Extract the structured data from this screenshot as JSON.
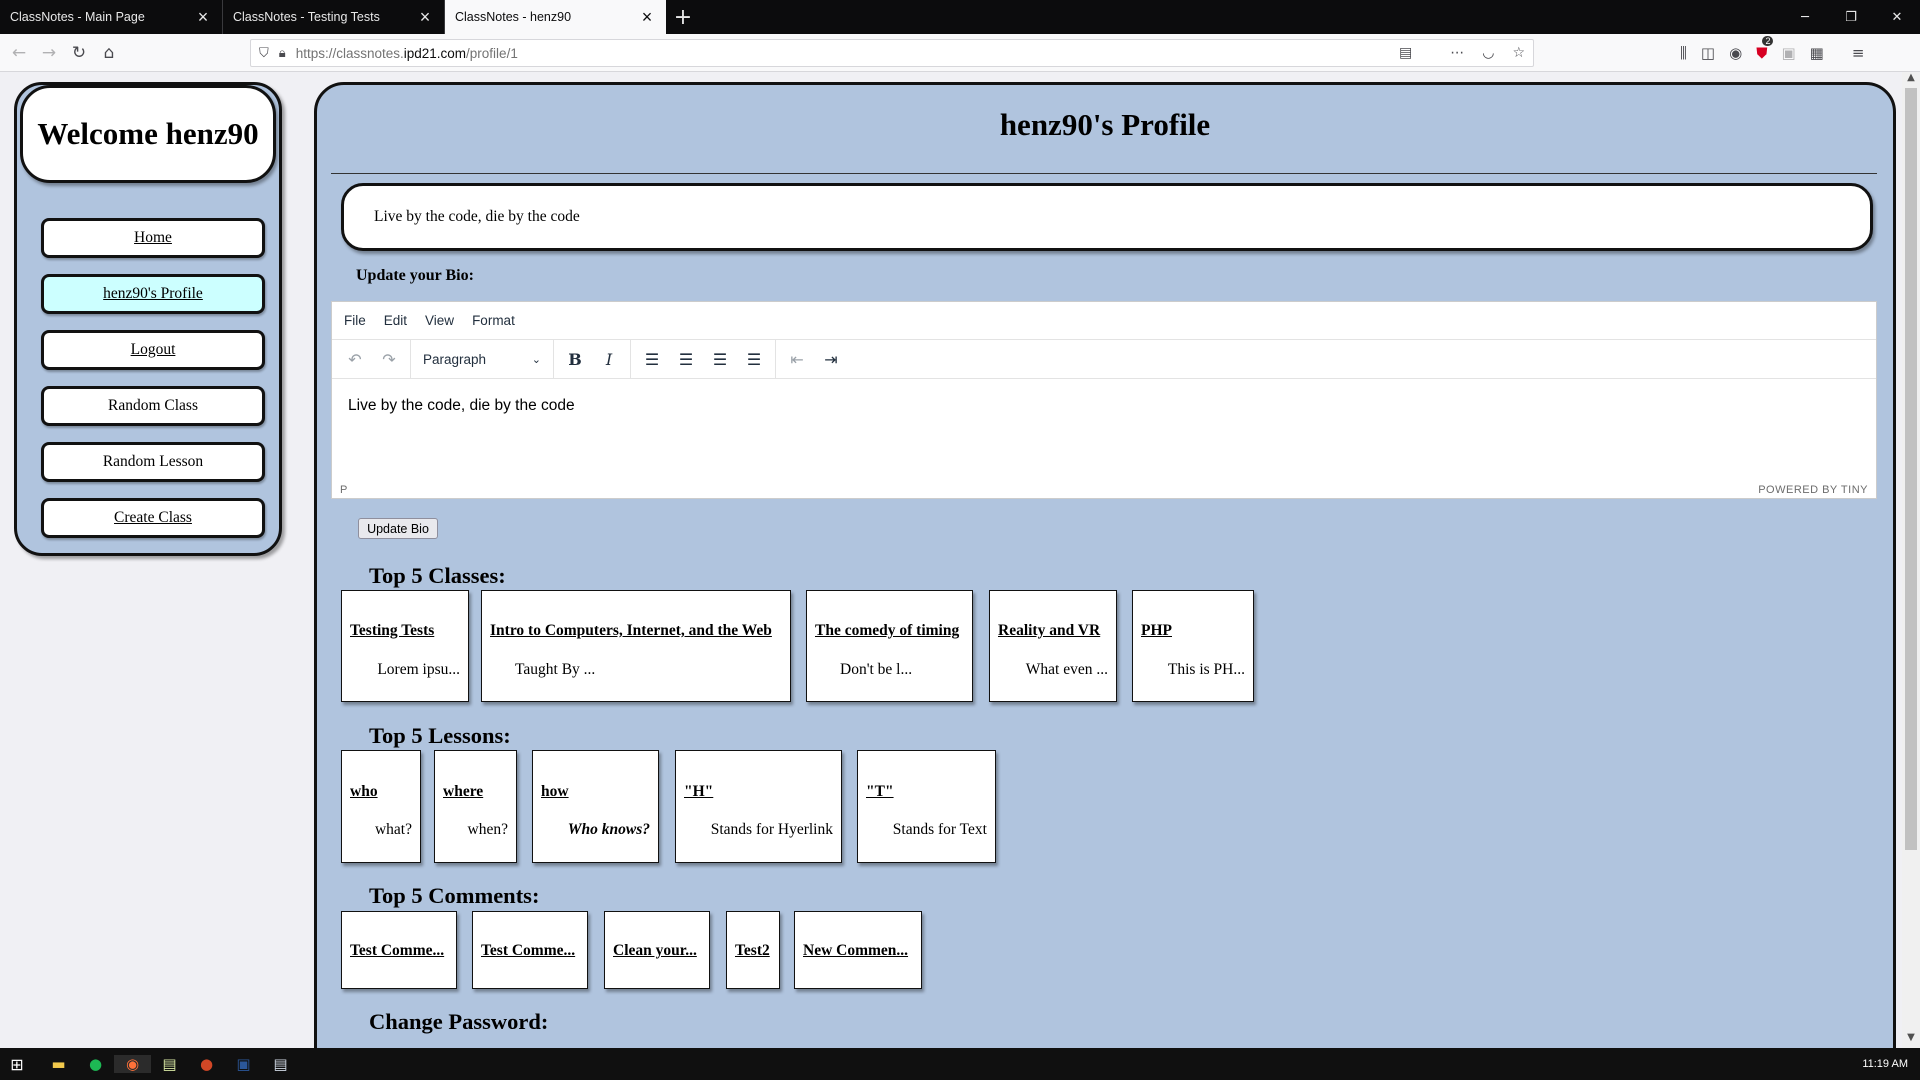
{
  "browser": {
    "tabs": [
      {
        "title": "ClassNotes - Main Page"
      },
      {
        "title": "ClassNotes - Testing Tests"
      },
      {
        "title": "ClassNotes - henz90"
      }
    ],
    "url_prefix": "https://classnotes.",
    "url_host": "ipd21.com",
    "url_path": "/profile/1",
    "extension_badge": "2"
  },
  "sidebar": {
    "welcome": "Welcome henz90",
    "items": [
      {
        "label": "Home"
      },
      {
        "label": "henz90's Profile"
      },
      {
        "label": "Logout"
      },
      {
        "label": "Random Class"
      },
      {
        "label": "Random Lesson"
      },
      {
        "label": "Create Class"
      }
    ]
  },
  "profile": {
    "title": "henz90's Profile",
    "bio": "Live by the code, die by the code",
    "update_label": "Update your Bio:",
    "update_button": "Update Bio"
  },
  "editor": {
    "menu": [
      "File",
      "Edit",
      "View",
      "Format"
    ],
    "format_select": "Paragraph",
    "content": "Live by the code, die by the code",
    "status_path": "P",
    "powered_by": "POWERED BY TINY"
  },
  "classes": {
    "heading": "Top 5 Classes:",
    "items": [
      {
        "title": "Testing Tests",
        "desc": "Lorem ipsu..."
      },
      {
        "title": "Intro to Computers, Internet, and the Web",
        "desc": "Taught By ..."
      },
      {
        "title": "The comedy of timing",
        "desc": "Don't be l..."
      },
      {
        "title": "Reality and VR",
        "desc": "What even ..."
      },
      {
        "title": "PHP",
        "desc": "This is PH..."
      }
    ]
  },
  "lessons": {
    "heading": "Top 5 Lessons:",
    "items": [
      {
        "title": "who",
        "desc": "what?"
      },
      {
        "title": "where",
        "desc": "when?"
      },
      {
        "title": "how",
        "desc": "Who knows?"
      },
      {
        "title": "\"H\"",
        "desc": "Stands for Hyerlink"
      },
      {
        "title": "\"T\"",
        "desc": "Stands for Text"
      }
    ]
  },
  "comments": {
    "heading": "Top 5 Comments:",
    "items": [
      {
        "title": "Test Comme..."
      },
      {
        "title": "Test Comme..."
      },
      {
        "title": "Clean your..."
      },
      {
        "title": "Test2"
      },
      {
        "title": "New Commen..."
      }
    ]
  },
  "password": {
    "heading": "Change Password:"
  },
  "colors": {
    "panel": "#b0c4de",
    "active_nav": "#ccffff"
  }
}
